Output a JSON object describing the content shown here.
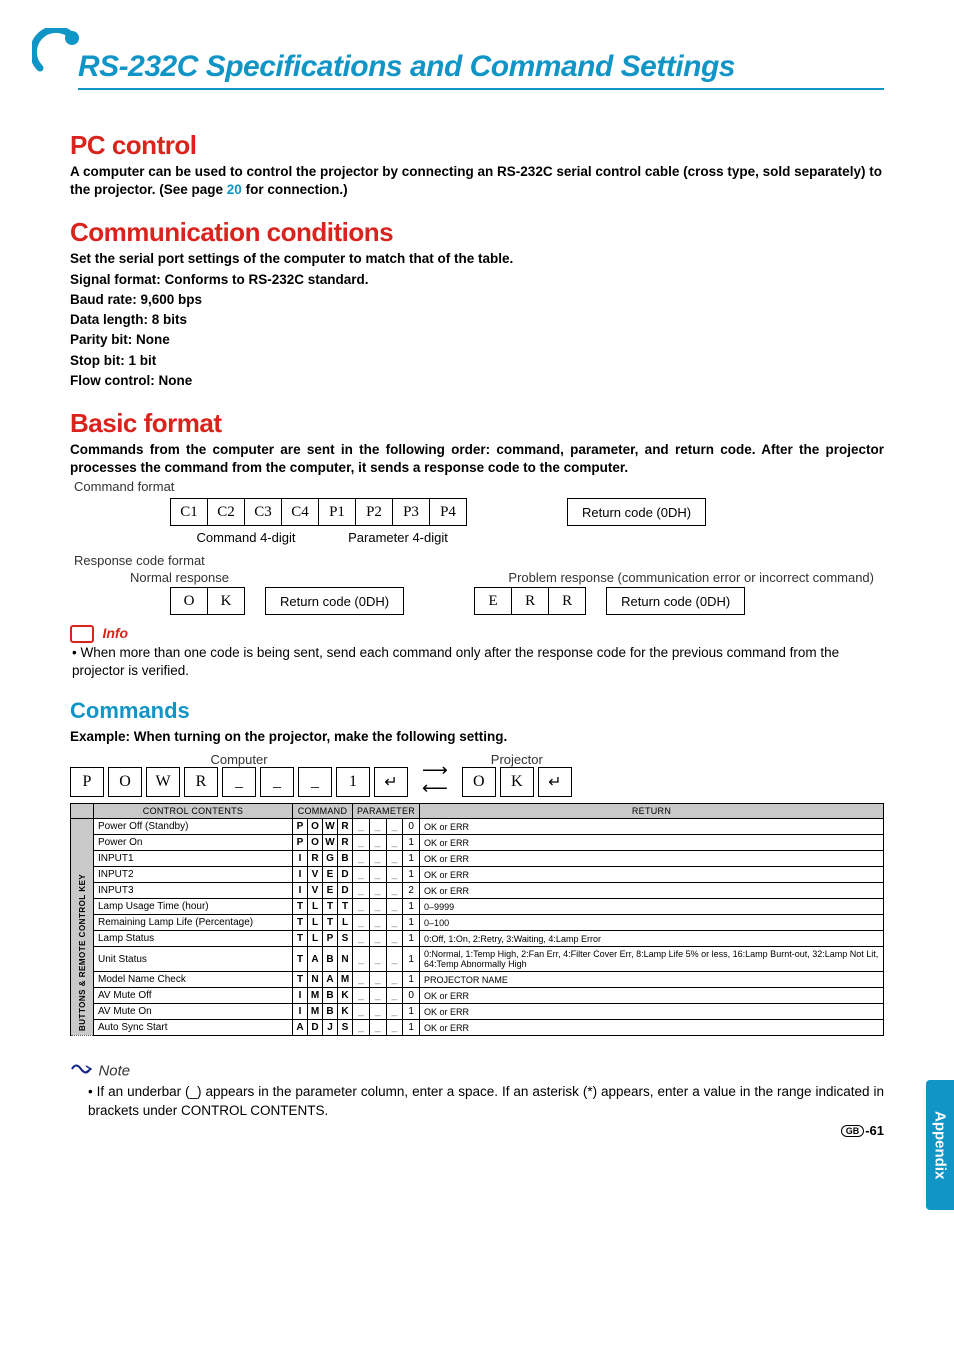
{
  "header": {
    "title": "RS-232C Specifications and Command Settings"
  },
  "sections": {
    "pc_control": {
      "heading": "PC control",
      "text_pre": "A computer can be used to control the projector by connecting an RS-232C serial control cable (cross type, sold separately) to the projector. (See page ",
      "page_link": "20",
      "text_post": " for connection.)"
    },
    "comm": {
      "heading": "Communication conditions",
      "lines": [
        "Set the serial port settings of the computer to match that of the table.",
        "Signal format: Conforms to RS-232C standard.",
        "Baud rate: 9,600 bps",
        "Data length: 8 bits",
        "Parity bit: None",
        "Stop bit: 1 bit",
        "Flow control: None"
      ]
    },
    "basic": {
      "heading": "Basic format",
      "text": "Commands from the computer are sent in the following order: command, parameter, and return code. After the projector processes the command from the computer, it sends a response code to the computer.",
      "cmd_format_label": "Command format",
      "cmd_cells": [
        "C1",
        "C2",
        "C3",
        "C4",
        "P1",
        "P2",
        "P3",
        "P4"
      ],
      "return_code": "Return code (0DH)",
      "command4": "Command 4-digit",
      "param4": "Parameter 4-digit",
      "resp_label": "Response code format",
      "normal_label": "Normal response",
      "problem_label": "Problem response (communication error or incorrect command)",
      "ok_cells": [
        "O",
        "K"
      ],
      "err_cells": [
        "E",
        "R",
        "R"
      ],
      "info_label": "Info",
      "info_text": "When more than one code is being sent, send each command only after the response code for the previous command from the projector is verified."
    },
    "commands": {
      "heading": "Commands",
      "example_label": "Example: When turning on the projector, make the following setting.",
      "computer_label": "Computer",
      "projector_label": "Projector",
      "example_computer": [
        "P",
        "O",
        "W",
        "R",
        "_",
        "_",
        "_",
        "1",
        "↵"
      ],
      "example_projector": [
        "O",
        "K",
        "↵"
      ],
      "table": {
        "side_category": "BUTTONS & REMOTE CONTROL KEY",
        "headers": {
          "cc": "CONTROL CONTENTS",
          "cmd": "COMMAND",
          "param": "PARAMETER",
          "ret": "RETURN"
        },
        "rows": [
          {
            "name": "Power Off (Standby)",
            "cmd": [
              "P",
              "O",
              "W",
              "R"
            ],
            "param": [
              "_",
              "_",
              "_",
              "0"
            ],
            "ret": "OK or ERR",
            "dotted": true
          },
          {
            "name": "Power On",
            "cmd": [
              "P",
              "O",
              "W",
              "R"
            ],
            "param": [
              "_",
              "_",
              "_",
              "1"
            ],
            "ret": "OK or ERR"
          },
          {
            "name": "INPUT1",
            "cmd": [
              "I",
              "R",
              "G",
              "B"
            ],
            "param": [
              "_",
              "_",
              "_",
              "1"
            ],
            "ret": "OK or ERR",
            "dotted": true
          },
          {
            "name": "INPUT2",
            "cmd": [
              "I",
              "V",
              "E",
              "D"
            ],
            "param": [
              "_",
              "_",
              "_",
              "1"
            ],
            "ret": "OK or ERR",
            "dotted": true
          },
          {
            "name": "INPUT3",
            "cmd": [
              "I",
              "V",
              "E",
              "D"
            ],
            "param": [
              "_",
              "_",
              "_",
              "2"
            ],
            "ret": "OK or ERR"
          },
          {
            "name": "Lamp Usage Time (hour)",
            "cmd": [
              "T",
              "L",
              "T",
              "T"
            ],
            "param": [
              "_",
              "_",
              "_",
              "1"
            ],
            "ret": "0–9999",
            "dotted": true
          },
          {
            "name": "Remaining Lamp Life (Percentage)",
            "cmd": [
              "T",
              "L",
              "T",
              "L"
            ],
            "param": [
              "_",
              "_",
              "_",
              "1"
            ],
            "ret": "0–100"
          },
          {
            "name": "Lamp Status",
            "cmd": [
              "T",
              "L",
              "P",
              "S"
            ],
            "param": [
              "_",
              "_",
              "_",
              "1"
            ],
            "ret": "0:Off, 1:On, 2:Retry, 3:Waiting, 4:Lamp Error"
          },
          {
            "name": "Unit Status",
            "cmd": [
              "T",
              "A",
              "B",
              "N"
            ],
            "param": [
              "_",
              "_",
              "_",
              "1"
            ],
            "ret": "0:Normal, 1:Temp High, 2:Fan Err, 4:Filter Cover Err, 8:Lamp Life 5% or less, 16:Lamp Burnt-out, 32:Lamp Not Lit, 64:Temp Abnormally High"
          },
          {
            "name": "Model Name Check",
            "cmd": [
              "T",
              "N",
              "A",
              "M"
            ],
            "param": [
              "_",
              "_",
              "_",
              "1"
            ],
            "ret": "PROJECTOR NAME"
          },
          {
            "name": "AV Mute Off",
            "cmd": [
              "I",
              "M",
              "B",
              "K"
            ],
            "param": [
              "_",
              "_",
              "_",
              "0"
            ],
            "ret": "OK or ERR",
            "dotted": true
          },
          {
            "name": "AV Mute On",
            "cmd": [
              "I",
              "M",
              "B",
              "K"
            ],
            "param": [
              "_",
              "_",
              "_",
              "1"
            ],
            "ret": "OK or ERR"
          },
          {
            "name": "Auto Sync Start",
            "cmd": [
              "A",
              "D",
              "J",
              "S"
            ],
            "param": [
              "_",
              "_",
              "_",
              "1"
            ],
            "ret": "OK or ERR"
          }
        ]
      }
    },
    "note": {
      "label": "Note",
      "text": "If an underbar (_)  appears in the parameter column, enter a space. If an asterisk (*) appears, enter a value in the range indicated in brackets under CONTROL CONTENTS."
    }
  },
  "side_tab": "Appendix",
  "page_number": {
    "badge": "GB",
    "num": "-61"
  }
}
